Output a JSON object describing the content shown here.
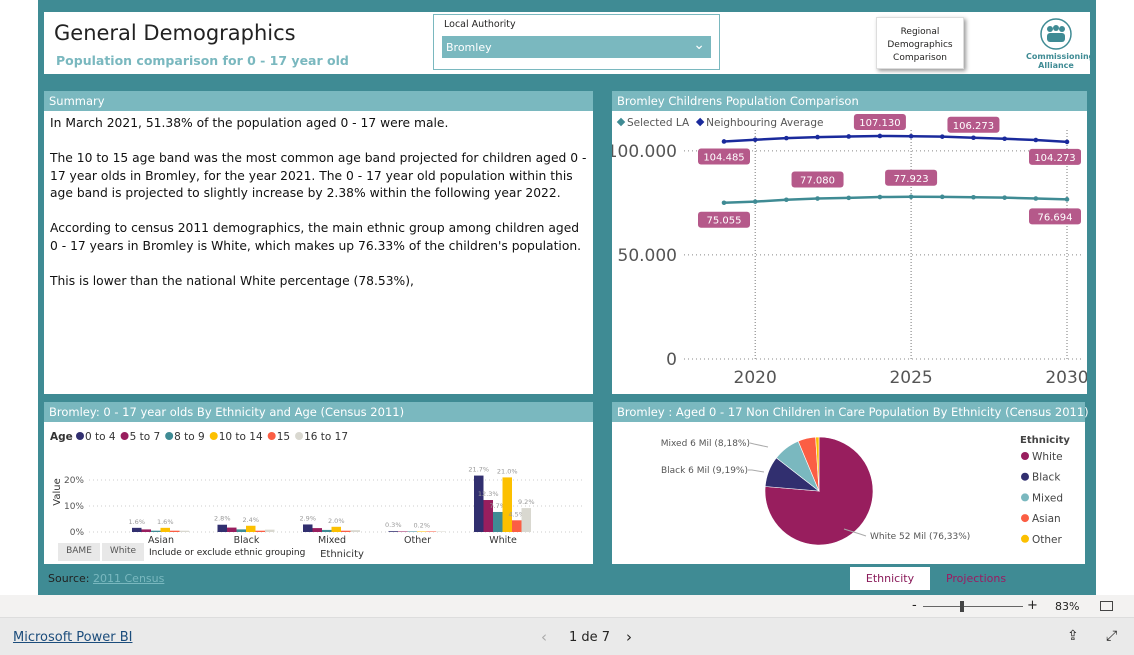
{
  "header": {
    "title": "General Demographics",
    "subtitle": "Population comparison for 0 - 17 year old",
    "slicer_label": "Local Authority",
    "slicer_value": "Bromley",
    "regional_button": [
      "Regional",
      "Demographics",
      "Comparison"
    ],
    "logo_text": [
      "Commissioning",
      "Alliance"
    ]
  },
  "summary": {
    "title": "Summary",
    "paragraphs": [
      "In March 2021, 51.38% of the population aged 0 - 17 were male.",
      "The 10 to 15  age band was the most common age band projected for children aged 0 - 17 year olds in Bromley, for the year 2021. The 0 - 17 year old population within this age band is projected to slightly increase by 2.38% within the following year 2022.",
      "According to census 2011 demographics, the main ethnic group among children aged 0 - 17 years in Bromley is White, which makes up 76.33% of the children's population.",
      "This is lower than the national White percentage (78.53%),"
    ]
  },
  "chart_data": [
    {
      "type": "line",
      "title": "Bromley Childrens Population Comparison",
      "x": [
        2019,
        2020,
        2021,
        2022,
        2023,
        2024,
        2025,
        2026,
        2027,
        2028,
        2029,
        2030
      ],
      "x_ticks": [
        "2020",
        "2025",
        "2030"
      ],
      "y_ticks": [
        "0",
        "50.000",
        "100.000"
      ],
      "ylim": [
        0,
        110000
      ],
      "legend_position": "top-left",
      "series": [
        {
          "name": "Selected LA",
          "color": "#3f8b94",
          "values": [
            75055,
            75600,
            76500,
            77080,
            77400,
            77800,
            77923,
            77900,
            77700,
            77500,
            77100,
            76694
          ],
          "labels": {
            "0": "75.055",
            "3": "77.080",
            "6": "77.923",
            "11": "76.694"
          }
        },
        {
          "name": "Neighbouring Average",
          "color": "#1a2a9c",
          "values": [
            104485,
            105300,
            106100,
            106600,
            106900,
            107130,
            107000,
            106800,
            106273,
            105800,
            105200,
            104273
          ],
          "labels": {
            "0": "104.485",
            "5": "107.130",
            "8": "106.273",
            "11": "104.273"
          }
        }
      ]
    },
    {
      "type": "bar",
      "title": "Bromley: 0 - 17 year olds By Ethnicity and Age (Census 2011)",
      "legend_title": "Age",
      "xlabel": "Ethnicity",
      "ylabel": "Value",
      "categories": [
        "Asian",
        "Black",
        "Mixed",
        "Other",
        "White"
      ],
      "y_ticks": [
        "0%",
        "10%",
        "20%"
      ],
      "ylim": [
        0,
        25
      ],
      "series": [
        {
          "name": "0 to 4",
          "color": "#312f6f",
          "values": [
            1.6,
            2.8,
            2.9,
            0.3,
            21.7
          ],
          "labels": [
            "1.6%",
            "2.8%",
            "2.9%",
            "0.3%",
            "21.7%"
          ]
        },
        {
          "name": "5 to 7",
          "color": "#981e5e",
          "values": [
            1.0,
            1.7,
            1.5,
            0.2,
            12.3
          ],
          "labels": [
            "",
            "",
            "",
            "",
            "12.3%"
          ]
        },
        {
          "name": "8 to 9",
          "color": "#3f8b94",
          "values": [
            0.5,
            1.0,
            0.8,
            0.2,
            7.7
          ],
          "labels": [
            "",
            "",
            "",
            "",
            "7.7%"
          ]
        },
        {
          "name": "10 to 14",
          "color": "#fcc000",
          "values": [
            1.6,
            2.4,
            2.0,
            0.2,
            21.0
          ],
          "labels": [
            "1.6%",
            "2.4%",
            "2.0%",
            "0.2%",
            "21.0%"
          ]
        },
        {
          "name": "15",
          "color": "#fb5e44",
          "values": [
            0.5,
            0.5,
            0.5,
            0.2,
            4.5
          ],
          "labels": [
            "",
            "",
            "",
            "",
            "4.5%"
          ]
        },
        {
          "name": "16 to 17",
          "color": "#d9d8d0",
          "values": [
            0.5,
            0.9,
            0.7,
            0.2,
            9.2
          ],
          "labels": [
            "",
            "",
            "",
            "",
            "9.2%"
          ]
        }
      ],
      "buttons": [
        "BAME",
        "White"
      ],
      "button_caption": "Include or exclude ethnic grouping"
    },
    {
      "type": "pie",
      "title": "Bromley : Aged 0 - 17 Non Children in Care Population By Ethnicity (Census 2011)",
      "legend_title": "Ethnicity",
      "legend_position": "right",
      "slices": [
        {
          "name": "White",
          "value": 76.33,
          "color": "#981e5e",
          "label": "White 52 Mil (76,33%)"
        },
        {
          "name": "Black",
          "value": 9.19,
          "color": "#312f6f",
          "label": "Black 6 Mil (9,19%)"
        },
        {
          "name": "Mixed",
          "value": 8.18,
          "color": "#7ab8bf",
          "label": "Mixed 6 Mil (8,18%)"
        },
        {
          "name": "Asian",
          "value": 5.3,
          "color": "#fb5e44",
          "label": ""
        },
        {
          "name": "Other",
          "value": 1.0,
          "color": "#fcc000",
          "label": ""
        }
      ]
    }
  ],
  "source": {
    "label": "Source:",
    "link": "2011 Census"
  },
  "tabs": [
    "Ethnicity",
    "Projections"
  ],
  "zoom": {
    "minus": "-",
    "plus": "+",
    "level": "83%",
    "value": 83
  },
  "footer": {
    "brand": "Microsoft Power BI",
    "page": "1 de 7"
  }
}
